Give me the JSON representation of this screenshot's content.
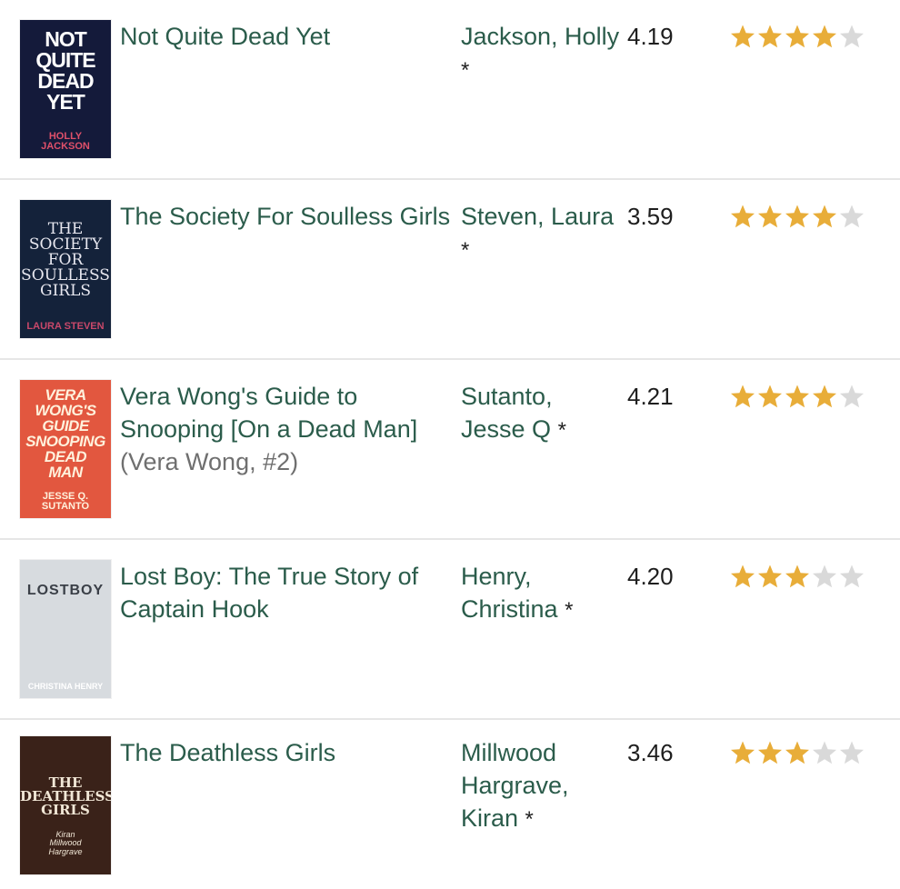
{
  "colors": {
    "title_link": "#2b5c4b",
    "series_text": "#6f6f6f",
    "rating_text": "#1e1e1e",
    "star_filled": "#e8ad39",
    "star_empty": "#d9d9d9",
    "divider": "#e6e6e6"
  },
  "books": [
    {
      "title": "Not Quite Dead Yet",
      "series": "",
      "author": "Jackson, Holly",
      "author_suffix": "*",
      "avg_rating": "4.19",
      "user_stars": 4,
      "cover": {
        "bg": "#141a3a",
        "accent": "#ffffff",
        "text": "NOT\nQUITE\nDEAD\nYET",
        "author": "HOLLY\nJACKSON",
        "author_color": "#e0506a"
      }
    },
    {
      "title": "The Society For Soulless Girls",
      "series": "",
      "author": "Steven, Laura",
      "author_suffix": "*",
      "avg_rating": "3.59",
      "user_stars": 4,
      "cover": {
        "bg": "#14223a",
        "accent": "#e8e8f0",
        "text": "THE\nSOCIETY\nFOR\nSOULLESS\nGIRLS",
        "author": "LAURA STEVEN",
        "author_color": "#c9486a"
      }
    },
    {
      "title": "Vera Wong's Guide to Snooping [On a Dead Man]",
      "series": "(Vera Wong, #2)",
      "author": "Sutanto, Jesse Q",
      "author_suffix": "*",
      "avg_rating": "4.21",
      "user_stars": 4,
      "cover": {
        "bg": "#e2573f",
        "accent": "#fff1dc",
        "text": "VERA\nWONG'S\nGUIDE\nSNOOPING\nDEAD\nMAN",
        "author": "JESSE Q. SUTANTO",
        "author_color": "#fff1dc"
      }
    },
    {
      "title": "Lost Boy: The True Story of Captain Hook",
      "series": "",
      "author": "Henry, Christina",
      "author_suffix": "*",
      "avg_rating": "4.20",
      "user_stars": 3,
      "cover": {
        "bg": "#d7dbdf",
        "accent": "#3a3f47",
        "text": "LOSTBOY",
        "author": "CHRISTINA HENRY",
        "author_color": "#ffffff"
      }
    },
    {
      "title": "The Deathless Girls",
      "series": "",
      "author": "Millwood Hargrave, Kiran",
      "author_suffix": "*",
      "avg_rating": "3.46",
      "user_stars": 3,
      "cover": {
        "bg": "#3a2219",
        "accent": "#f1e7d6",
        "text": "THE\nDEATHLESS\nGIRLS",
        "author": "Kiran\nMillwood\nHargrave",
        "author_color": "#f1e7d6"
      }
    }
  ]
}
